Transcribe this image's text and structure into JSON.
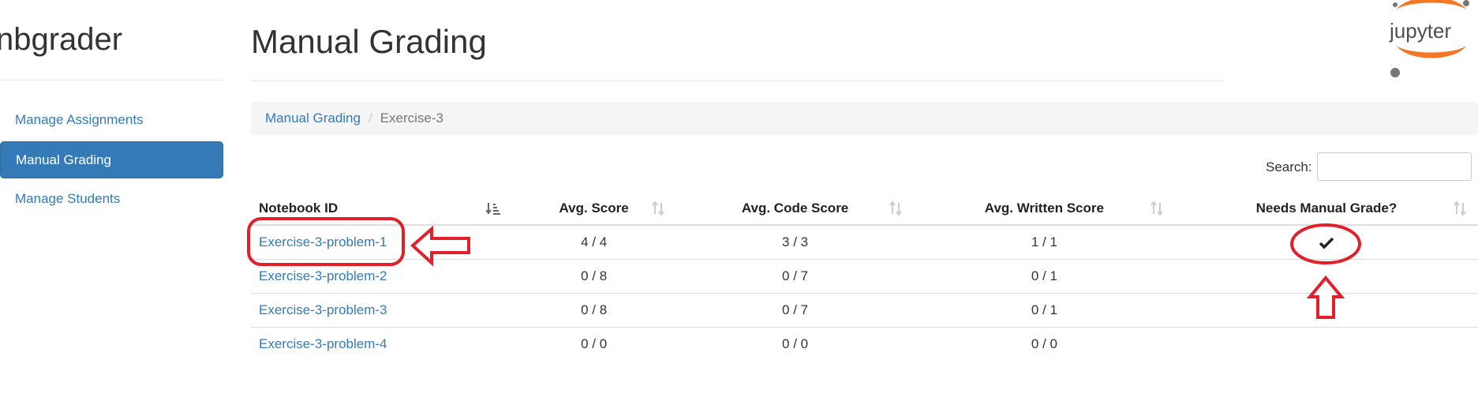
{
  "sidebar": {
    "app_title": "nbgrader",
    "items": [
      {
        "label": "Manage Assignments"
      },
      {
        "label": "Manual Grading"
      },
      {
        "label": "Manage Students"
      }
    ]
  },
  "main": {
    "title": "Manual Grading",
    "breadcrumb": {
      "root": "Manual Grading",
      "separator": "/",
      "current": "Exercise-3"
    },
    "search": {
      "label": "Search:",
      "value": ""
    },
    "table": {
      "headers": [
        "Notebook ID",
        "Avg. Score",
        "Avg. Code Score",
        "Avg. Written Score",
        "Needs Manual Grade?"
      ],
      "rows": [
        {
          "notebook": "Exercise-3-problem-1",
          "score": "4 / 4",
          "code": "3 / 3",
          "written": "1 / 1",
          "needs_manual": true
        },
        {
          "notebook": "Exercise-3-problem-2",
          "score": "0 / 8",
          "code": "0 / 7",
          "written": "0 / 1",
          "needs_manual": false
        },
        {
          "notebook": "Exercise-3-problem-3",
          "score": "0 / 8",
          "code": "0 / 7",
          "written": "0 / 1",
          "needs_manual": false
        },
        {
          "notebook": "Exercise-3-problem-4",
          "score": "0 / 0",
          "code": "0 / 0",
          "written": "0 / 0",
          "needs_manual": false
        }
      ]
    }
  },
  "logo": {
    "text": "jupyter",
    "orange": "#f37726",
    "gray": "#767677"
  },
  "colors": {
    "link": "#337ab7",
    "active_bg": "#337ab7",
    "annotation": "#e0202a"
  }
}
